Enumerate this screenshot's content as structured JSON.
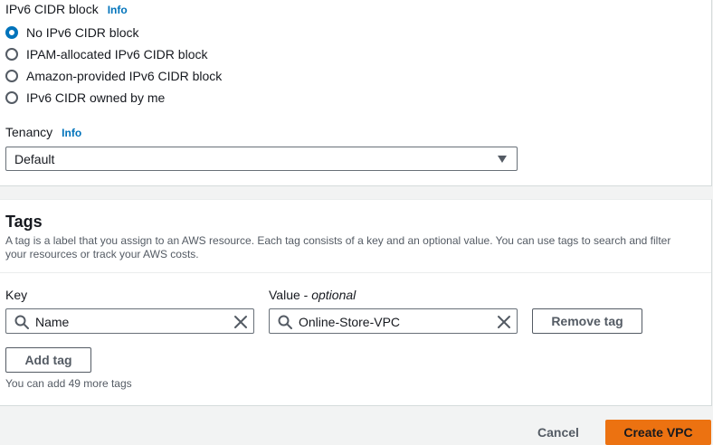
{
  "ipv6": {
    "label": "IPv6 CIDR block",
    "info": "Info",
    "options": [
      {
        "label": "No IPv6 CIDR block",
        "selected": true
      },
      {
        "label": "IPAM-allocated IPv6 CIDR block",
        "selected": false
      },
      {
        "label": "Amazon-provided IPv6 CIDR block",
        "selected": false
      },
      {
        "label": "IPv6 CIDR owned by me",
        "selected": false
      }
    ]
  },
  "tenancy": {
    "label": "Tenancy",
    "info": "Info",
    "selected": "Default"
  },
  "tags": {
    "title": "Tags",
    "description": "A tag is a label that you assign to an AWS resource. Each tag consists of a key and an optional value. You can use tags to search and filter your resources or track your AWS costs.",
    "key_label": "Key",
    "value_label": "Value - ",
    "value_optional": "optional",
    "rows": [
      {
        "key": "Name",
        "value": "Online-Store-VPC",
        "remove_label": "Remove tag"
      }
    ],
    "add_label": "Add tag",
    "hint": "You can add 49 more tags"
  },
  "footer": {
    "cancel_label": "Cancel",
    "create_label": "Create VPC"
  },
  "colors": {
    "accent": "#0073bb",
    "primary_button": "#ec7211",
    "border": "#687078"
  }
}
